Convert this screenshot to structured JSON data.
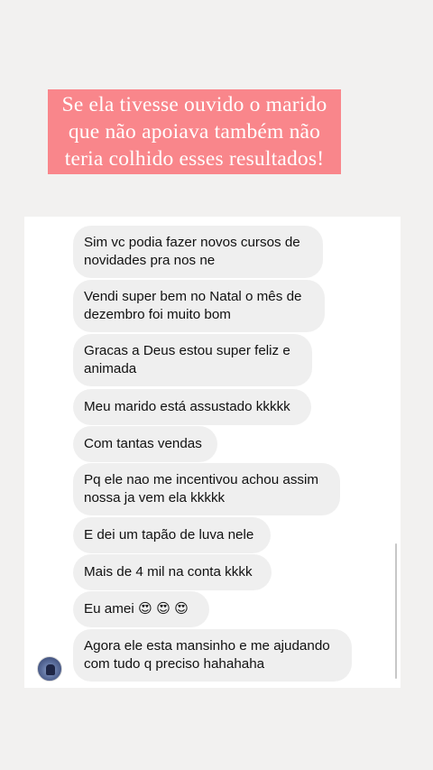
{
  "caption": {
    "lines": [
      "Se ela tivesse ouvido o marido",
      "que não apoiava também não",
      "teria colhido esses resultados!"
    ]
  },
  "chat": {
    "messages": [
      {
        "lines": [
          "Sim vc podia fazer novos cursos de",
          "novidades pra nos ne"
        ]
      },
      {
        "lines": [
          "Vendi super bem no Natal o mês de",
          "dezembro foi muito bom"
        ]
      },
      {
        "lines": [
          "Gracas a Deus estou super feliz e",
          "animada"
        ]
      },
      {
        "lines": [
          "Meu marido está assustado kkkkk"
        ]
      },
      {
        "lines": [
          "Com tantas vendas"
        ]
      },
      {
        "lines": [
          "Pq ele nao me incentivou achou assim",
          "nossa ja vem ela kkkkk"
        ]
      },
      {
        "lines": [
          "E dei um tapão de luva nele"
        ]
      },
      {
        "lines": [
          "Mais de 4 mil na conta kkkk"
        ]
      },
      {
        "lines": [
          "Eu amei 😍 😍 😍"
        ]
      },
      {
        "lines": [
          "Agora ele esta mansinho e me ajudando",
          "com tudo q preciso hahahaha"
        ]
      }
    ],
    "avatar_icon": "profile-avatar-icon"
  }
}
